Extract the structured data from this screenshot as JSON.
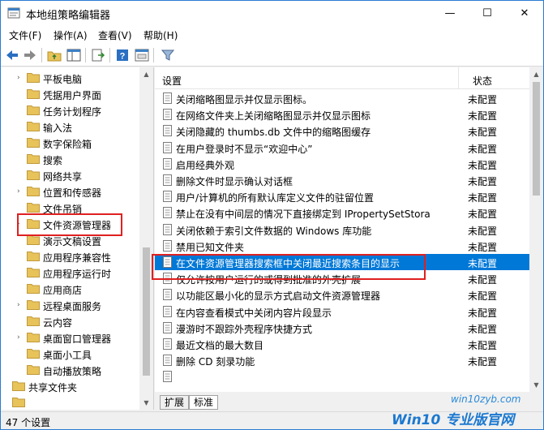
{
  "window": {
    "title": "本地组策略编辑器",
    "buttons": {
      "minimize": "—",
      "maximize": "☐",
      "close": "✕"
    }
  },
  "menu": {
    "items": [
      "文件(F)",
      "操作(A)",
      "查看(V)",
      "帮助(H)"
    ]
  },
  "toolbar": {
    "icons": [
      "back-arrow-icon",
      "forward-arrow-icon",
      "up-folder-icon",
      "show-hide-tree-icon",
      "export-list-icon",
      "help-icon",
      "properties-icon",
      "filter-icon"
    ]
  },
  "tree": {
    "items": [
      {
        "label": "平板电脑",
        "expandable": true
      },
      {
        "label": "凭据用户界面",
        "expandable": false
      },
      {
        "label": "任务计划程序",
        "expandable": false
      },
      {
        "label": "输入法",
        "expandable": false
      },
      {
        "label": "数字保险箱",
        "expandable": false
      },
      {
        "label": "搜索",
        "expandable": false
      },
      {
        "label": "网络共享",
        "expandable": false
      },
      {
        "label": "位置和传感器",
        "expandable": true
      },
      {
        "label": "文件吊销",
        "expandable": false
      },
      {
        "label": "文件资源管理器",
        "expandable": true,
        "selected": true
      },
      {
        "label": "演示文稿设置",
        "expandable": false
      },
      {
        "label": "应用程序兼容性",
        "expandable": false
      },
      {
        "label": "应用程序运行时",
        "expandable": false
      },
      {
        "label": "应用商店",
        "expandable": false
      },
      {
        "label": "远程桌面服务",
        "expandable": true
      },
      {
        "label": "云内容",
        "expandable": false
      },
      {
        "label": "桌面窗口管理器",
        "expandable": true
      },
      {
        "label": "桌面小工具",
        "expandable": false
      },
      {
        "label": "自动播放策略",
        "expandable": false
      },
      {
        "label": "共享文件夹",
        "expandable": false
      },
      {
        "label": "",
        "expandable": false
      }
    ]
  },
  "list": {
    "header": {
      "setting": "设置",
      "status": "状态"
    },
    "rows": [
      {
        "name": "关闭缩略图显示并仅显示图标。",
        "status": "未配置"
      },
      {
        "name": "在网络文件夹上关闭缩略图显示并仅显示图标",
        "status": "未配置"
      },
      {
        "name": "关闭隐藏的 thumbs.db 文件中的缩略图缓存",
        "status": "未配置"
      },
      {
        "name": "在用户登录时不显示“欢迎中心”",
        "status": "未配置"
      },
      {
        "name": "启用经典外观",
        "status": "未配置"
      },
      {
        "name": "删除文件时显示确认对话框",
        "status": "未配置"
      },
      {
        "name": "用户/计算机的所有默认库定义文件的驻留位置",
        "status": "未配置"
      },
      {
        "name": "禁止在没有中间层的情况下直接绑定到 IPropertySetStora",
        "status": "未配置"
      },
      {
        "name": "关闭依赖于索引文件数据的 Windows 库功能",
        "status": "未配置"
      },
      {
        "name": "禁用已知文件夹",
        "status": "未配置"
      },
      {
        "name": "在文件资源管理器搜索框中关闭最近搜索条目的显示",
        "status": "未配置",
        "selected": true
      },
      {
        "name": "仅允许按用户运行的或得到批准的外壳扩展",
        "status": "未配置"
      },
      {
        "name": "以功能区最小化的显示方式启动文件资源管理器",
        "status": "未配置"
      },
      {
        "name": "在内容查看模式中关闭内容片段显示",
        "status": "未配置"
      },
      {
        "name": "漫游时不跟踪外壳程序快捷方式",
        "status": "未配置"
      },
      {
        "name": "最近文档的最大数目",
        "status": "未配置"
      },
      {
        "name": "删除 CD 刻录功能",
        "status": "未配置"
      },
      {
        "name": "",
        "status": ""
      }
    ]
  },
  "tabs": [
    "扩展",
    "标准"
  ],
  "status_bar": {
    "text": "47 个设置"
  },
  "watermark": {
    "url": "win10zyb.com",
    "brand": "Win10 专业版官网"
  },
  "colors": {
    "selection": "#0078d7",
    "annotation": "#e02020",
    "folder": "#e8c35a"
  }
}
